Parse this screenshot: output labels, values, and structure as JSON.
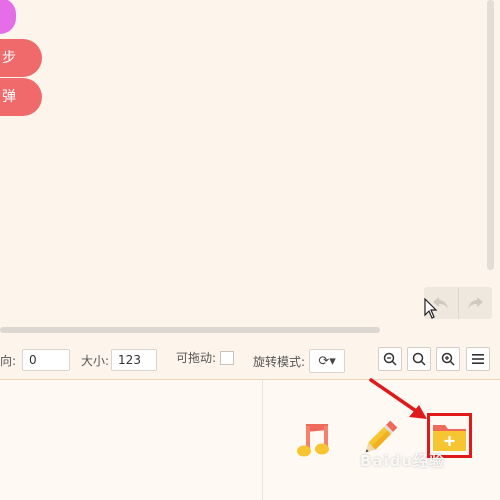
{
  "canvas": {
    "pills": [
      {
        "label": "",
        "color": "#e56ee8"
      },
      {
        "label": "步",
        "color": "#f06a6b"
      },
      {
        "label": "弹",
        "color": "#f06a6b"
      }
    ]
  },
  "history": {
    "undo_icon": "undo-icon",
    "redo_icon": "redo-icon"
  },
  "toolbar": {
    "direction_label": "向:",
    "direction_value": "0",
    "size_label": "大小:",
    "size_value": "123",
    "draggable_label": "可拖动:",
    "rotate_label": "旋转模式:",
    "rotate_value": "⟳▾",
    "zoom_out_icon": "zoom-out-icon",
    "zoom_reset_icon": "zoom-reset-icon",
    "zoom_in_icon": "zoom-in-icon",
    "menu_icon": "menu-icon"
  },
  "resources": {
    "music_icon": "music-icon",
    "paint_icon": "pencil-icon",
    "folder_add_icon": "folder-add-icon"
  },
  "watermark": "Baidu经验",
  "colors": {
    "accent_red": "#f06a6b",
    "highlight": "#e01a1a"
  }
}
